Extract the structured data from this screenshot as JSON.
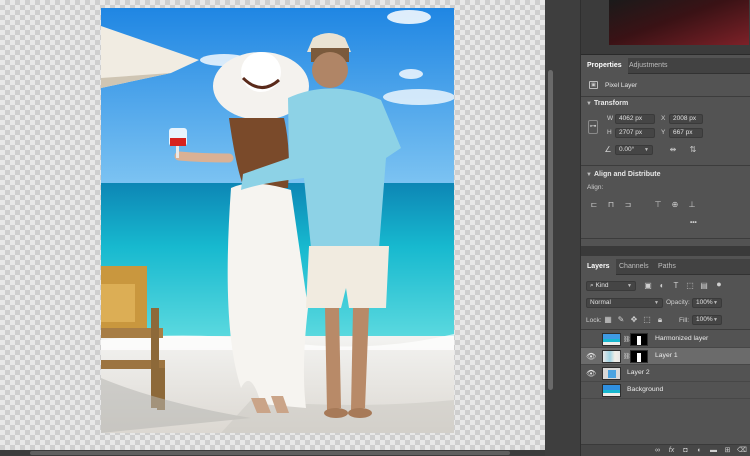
{
  "properties_panel": {
    "tabs": [
      {
        "label": "Properties",
        "active": true
      },
      {
        "label": "Adjustments",
        "active": false
      }
    ],
    "layer_type": "Pixel Layer",
    "transform": {
      "title": "Transform",
      "w_label": "W",
      "w_value": "4062 px",
      "h_label": "H",
      "h_value": "2707 px",
      "x_label": "X",
      "x_value": "2008 px",
      "y_label": "Y",
      "y_value": "667 px",
      "angle_value": "0.00°"
    },
    "align": {
      "title": "Align and Distribute",
      "align_label": "Align:",
      "more": "•••"
    }
  },
  "layers_panel": {
    "tabs": [
      {
        "label": "Layers",
        "active": true
      },
      {
        "label": "Channels",
        "active": false
      },
      {
        "label": "Paths",
        "active": false
      }
    ],
    "filter_kind": "Kind",
    "blend_mode": "Normal",
    "opacity_label": "Opacity:",
    "opacity_value": "100%",
    "lock_label": "Lock:",
    "fill_label": "Fill:",
    "fill_value": "100%",
    "layers": [
      {
        "name": "Harmonized layer",
        "visible": false,
        "selected": false,
        "has_mask": true
      },
      {
        "name": "Layer 1",
        "visible": true,
        "selected": true,
        "has_mask": true
      },
      {
        "name": "Layer 2",
        "visible": true,
        "selected": false,
        "has_mask": false
      },
      {
        "name": "Background",
        "visible": false,
        "selected": false,
        "has_mask": false
      }
    ]
  },
  "colors": {
    "panel_bg": "#535353",
    "selected_layer": "#6b6b6b",
    "sky": "#3f9be4",
    "sea": "#1fc4d2",
    "sand": "#eeece8"
  }
}
